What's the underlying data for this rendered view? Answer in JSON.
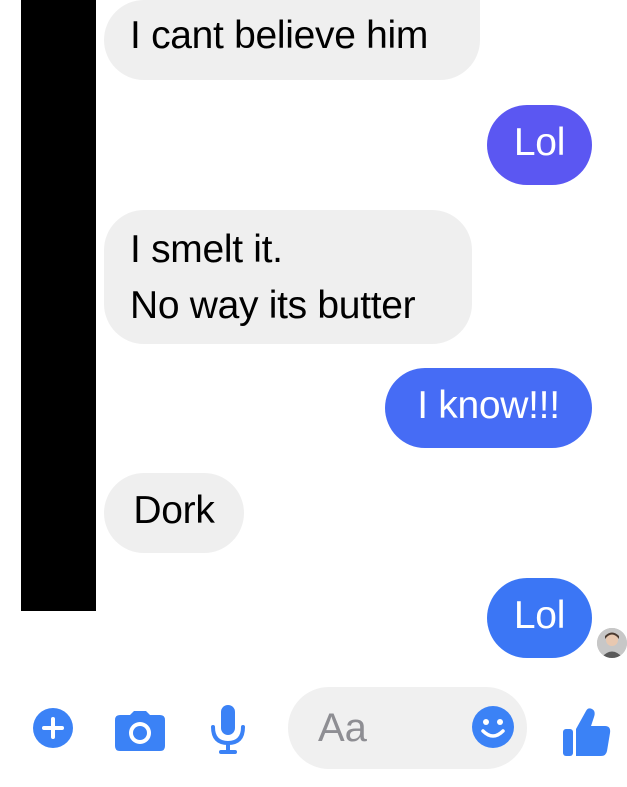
{
  "thread": {
    "messages": [
      {
        "direction": "incoming",
        "text": "I cant believe him"
      },
      {
        "direction": "outgoing",
        "text": "Lol"
      },
      {
        "direction": "incoming",
        "text": "I smelt it.\nNo way its butter"
      },
      {
        "direction": "outgoing",
        "text": "I know!!!"
      },
      {
        "direction": "incoming",
        "text": "Dork"
      },
      {
        "direction": "outgoing",
        "text": "Lol"
      }
    ]
  },
  "composer": {
    "placeholder": "Aa",
    "icons": [
      "plus-circle-icon",
      "camera-icon",
      "microphone-icon",
      "smiley-icon",
      "thumbs-up-icon"
    ]
  },
  "colors": {
    "accent": "#3b82f6",
    "outgoing_1": "#5b57f2",
    "outgoing_2": "#466cf5",
    "outgoing_3": "#3b76f5",
    "incoming": "#efefef",
    "redaction": "#000000"
  }
}
